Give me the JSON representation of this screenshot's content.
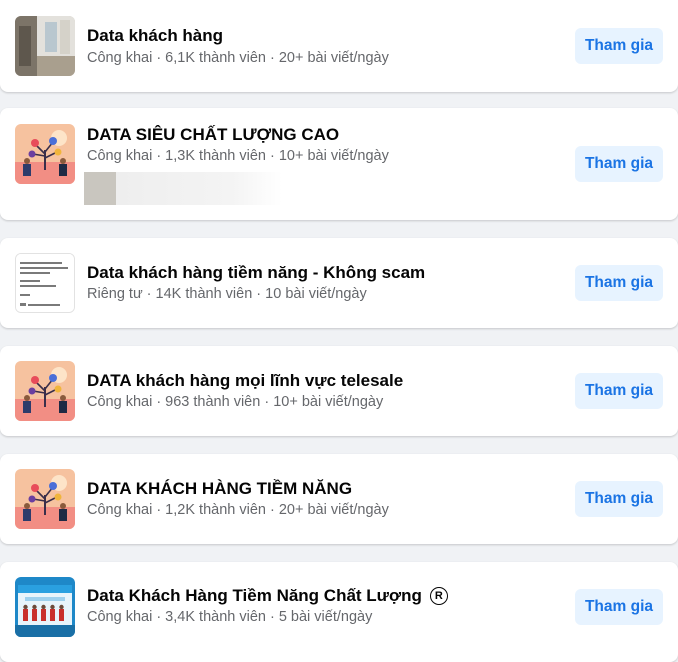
{
  "groups": [
    {
      "name": "Data khách hàng",
      "meta": "Công khai · 6,1K thành viên · 20+ bài viết/ngày",
      "button": "Tham gia",
      "thumb_icon": "room-photo-icon"
    },
    {
      "name": "DATA SIÊU CHẤT LƯỢNG CAO",
      "meta": "Công khai · 1,3K thành viên · 10+ bài viết/ngày",
      "button": "Tham gia",
      "thumb_icon": "people-tree-illustration-icon"
    },
    {
      "name": "Data khách hàng tiềm năng - Không scam",
      "meta": "Riêng tư · 14K thành viên · 10 bài viết/ngày",
      "button": "Tham gia",
      "thumb_icon": "text-document-icon"
    },
    {
      "name": "DATA khách hàng mọi lĩnh vực telesale",
      "meta": "Công khai · 963 thành viên · 10+ bài viết/ngày",
      "button": "Tham gia",
      "thumb_icon": "people-tree-illustration-icon"
    },
    {
      "name": "DATA KHÁCH HÀNG TIỀM NĂNG",
      "meta": "Công khai · 1,2K thành viên · 20+ bài viết/ngày",
      "button": "Tham gia",
      "thumb_icon": "people-tree-illustration-icon"
    },
    {
      "name": "Data Khách Hàng Tiềm Năng Chất Lượng",
      "meta": "Công khai · 3,4K thành viên · 5 bài viết/ngày",
      "button": "Tham gia",
      "thumb_icon": "team-banner-icon",
      "badge": "R"
    }
  ],
  "colors": {
    "page_bg": "#f0f2f5",
    "card_bg": "#ffffff",
    "title": "#050505",
    "meta": "#65676b",
    "button_bg": "#e7f3ff",
    "button_text": "#1b74e4"
  }
}
